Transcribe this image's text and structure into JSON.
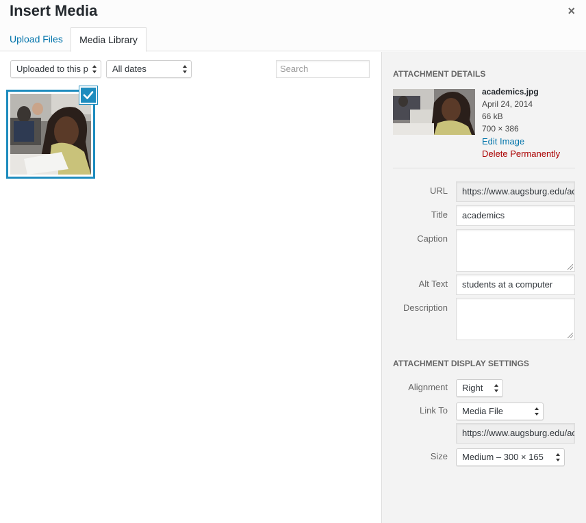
{
  "dialog": {
    "title": "Insert Media",
    "close": "×"
  },
  "tabs": [
    {
      "label": "Upload Files",
      "active": false
    },
    {
      "label": "Media Library",
      "active": true
    }
  ],
  "toolbar": {
    "filter_select": "Uploaded to this p",
    "date_select": "All dates",
    "search_placeholder": "Search"
  },
  "library": {
    "items": [
      {
        "selected": true,
        "alt": "students at a computer"
      }
    ]
  },
  "details": {
    "heading": "Attachment Details",
    "filename": "academics.jpg",
    "date": "April 24, 2014",
    "size": "66 kB",
    "dimensions": "700 × 386",
    "edit_link": "Edit Image",
    "delete_link": "Delete Permanently"
  },
  "fields": {
    "url_label": "URL",
    "url_value": "https://www.augsburg.edu/academics",
    "title_label": "Title",
    "title_value": "academics",
    "caption_label": "Caption",
    "caption_value": "",
    "alt_label": "Alt Text",
    "alt_value": "students at a computer",
    "description_label": "Description",
    "description_value": ""
  },
  "display": {
    "heading": "Attachment Display Settings",
    "alignment_label": "Alignment",
    "alignment_value": "Right",
    "link_label": "Link To",
    "link_value": "Media File",
    "link_url": "https://www.augsburg.edu/academics",
    "size_label": "Size",
    "size_value": "Medium – 300 × 165"
  },
  "colors": {
    "accent": "#1e8cbe",
    "link": "#0073aa",
    "delete": "#aa0000"
  }
}
